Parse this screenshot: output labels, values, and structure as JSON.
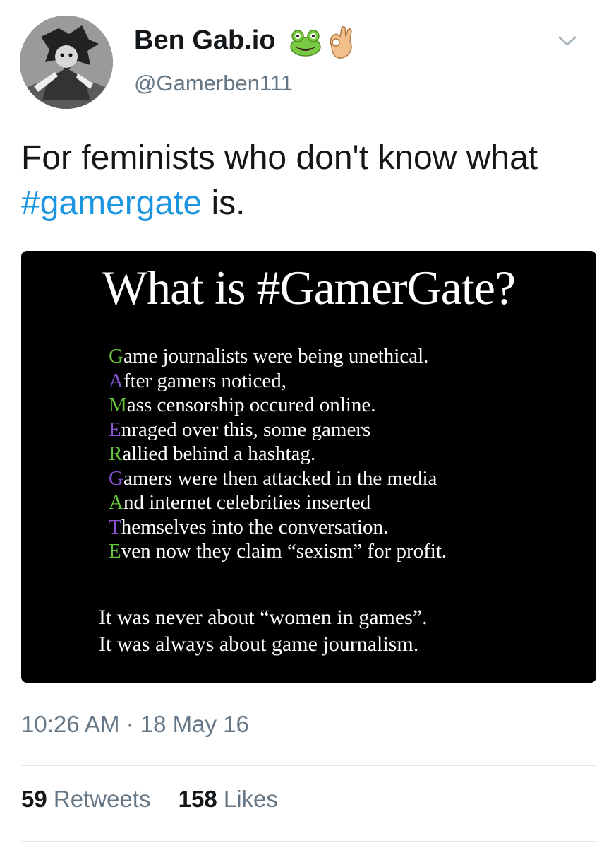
{
  "author": {
    "display_name": "Ben Gab.io",
    "handle": "@Gamerben111",
    "emojis": [
      "frog-emoji-icon",
      "ok-hand-emoji-icon"
    ]
  },
  "tweet": {
    "text_before": "For feminists who don't know what ",
    "hashtag": "#gamergate",
    "text_after": " is."
  },
  "media": {
    "title": "What is #GamerGate?",
    "acrostic": [
      {
        "letter": "G",
        "rest": "ame journalists were being unethical.",
        "color": "#66c23a"
      },
      {
        "letter": "A",
        "rest": "fter gamers noticed,",
        "color": "#8a56d6"
      },
      {
        "letter": "M",
        "rest": "ass censorship occured online.",
        "color": "#66c23a"
      },
      {
        "letter": "E",
        "rest": "nraged over this, some gamers",
        "color": "#8a56d6"
      },
      {
        "letter": "R",
        "rest": "allied behind a hashtag.",
        "color": "#66c23a"
      },
      {
        "letter": "G",
        "rest": "amers were then attacked in the media",
        "color": "#8a56d6"
      },
      {
        "letter": "A",
        "rest": "nd internet celebrities inserted",
        "color": "#66c23a"
      },
      {
        "letter": "T",
        "rest": "hemselves into the conversation.",
        "color": "#8a56d6"
      },
      {
        "letter": "E",
        "rest": "ven now they claim “sexism” for profit.",
        "color": "#66c23a"
      }
    ],
    "closing_1": "It was never about “women in games”.",
    "closing_2": "It was always about game journalism."
  },
  "meta": {
    "timestamp": "10:26 AM · 18 May 16"
  },
  "stats": {
    "retweets_count": "59",
    "retweets_label": "Retweets",
    "likes_count": "158",
    "likes_label": "Likes"
  },
  "colors": {
    "link": "#1b95e0",
    "muted": "#657786",
    "text": "#14171a"
  }
}
